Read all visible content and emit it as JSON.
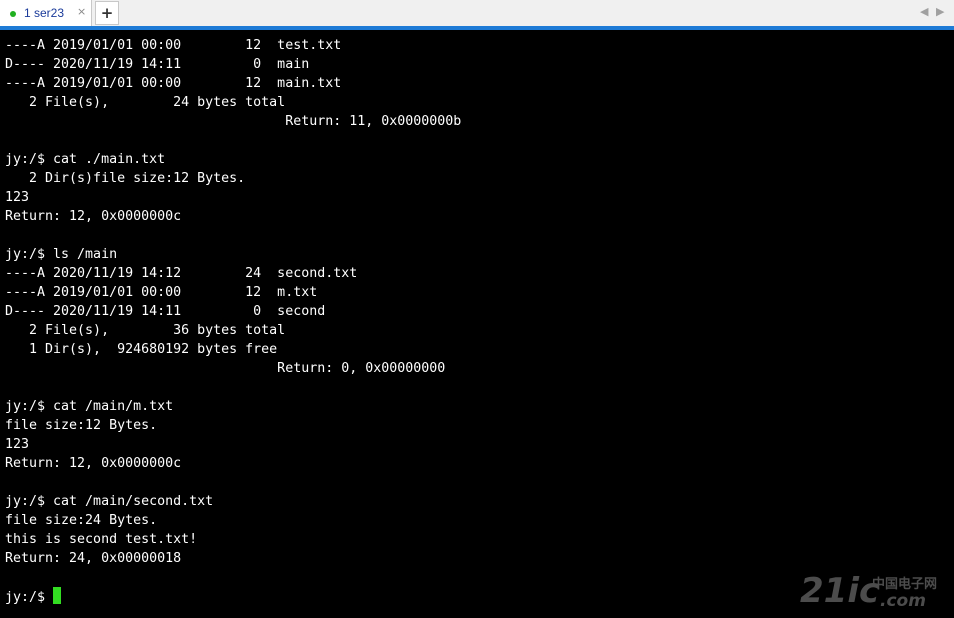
{
  "tabbar": {
    "tab_label": "1 ser23",
    "close_glyph": "×",
    "add_glyph": "+",
    "scroll_left_glyph": "◀",
    "scroll_right_glyph": "▶",
    "status_color": "#20b020",
    "accent_color": "#1e7bd6"
  },
  "terminal": {
    "background": "#000000",
    "text_color": "#ffffff",
    "cursor_color": "#33dd22",
    "lines": [
      "----A 2019/01/01 00:00        12  test.txt",
      "D---- 2020/11/19 14:11         0  main",
      "----A 2019/01/01 00:00        12  main.txt",
      "   2 File(s),        24 bytes total",
      "                                   Return: 11, 0x0000000b",
      "",
      "jy:/$ cat ./main.txt",
      "   2 Dir(s)file size:12 Bytes.",
      "123",
      "Return: 12, 0x0000000c",
      "",
      "jy:/$ ls /main",
      "----A 2020/11/19 14:12        24  second.txt",
      "----A 2019/01/01 00:00        12  m.txt",
      "D---- 2020/11/19 14:11         0  second",
      "   2 File(s),        36 bytes total",
      "   1 Dir(s),  924680192 bytes free",
      "                                  Return: 0, 0x00000000",
      "",
      "jy:/$ cat /main/m.txt",
      "file size:12 Bytes.",
      "123",
      "Return: 12, 0x0000000c",
      "",
      "jy:/$ cat /main/second.txt",
      "file size:24 Bytes.",
      "this is second test.txt!",
      "Return: 24, 0x00000018"
    ],
    "blank_line": "",
    "prompt": "jy:/$ "
  },
  "watermark": {
    "brand": "21ic",
    "site_cn": "中国电子网",
    "domain_suffix": ".com"
  }
}
